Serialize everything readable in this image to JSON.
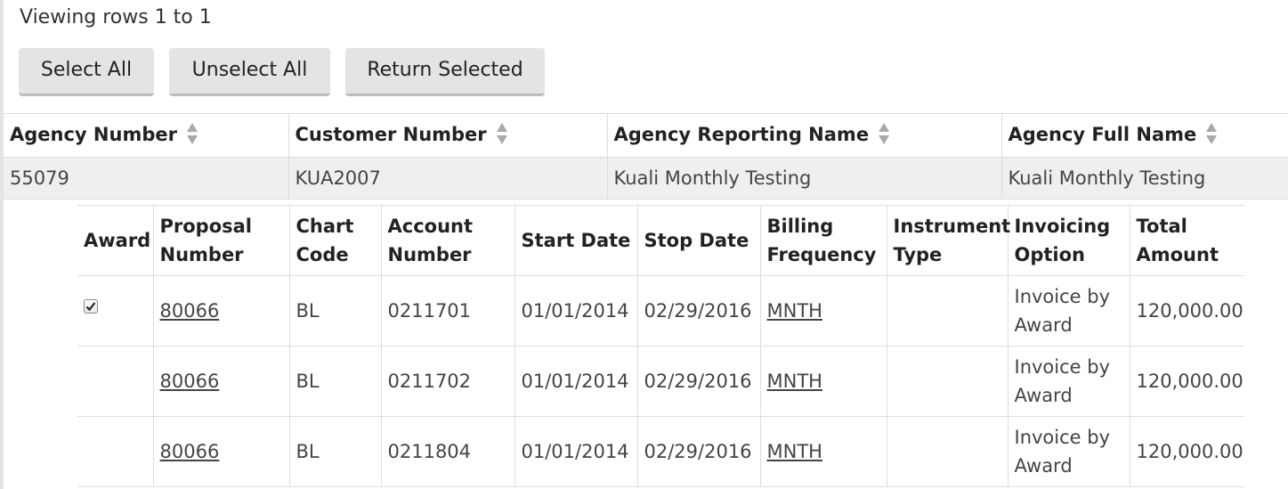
{
  "viewing_text": "Viewing rows 1 to 1",
  "buttons": {
    "select_all": "Select All",
    "unselect_all": "Unselect All",
    "return_selected": "Return Selected"
  },
  "outer_table": {
    "headers": [
      "Agency Number",
      "Customer Number",
      "Agency Reporting Name",
      "Agency Full Name"
    ],
    "rows": [
      [
        "55079",
        "KUA2007",
        "Kuali Monthly Testing",
        "Kuali Monthly Testing"
      ]
    ]
  },
  "inner_table": {
    "headers": [
      "Award",
      "Proposal Number",
      "Chart Code",
      "Account Number",
      "Start Date",
      "Stop Date",
      "Billing Frequency",
      "Instrument Type",
      "Invoicing Option",
      "Total Amount"
    ],
    "rows": [
      {
        "award_checked": true,
        "proposal": "80066",
        "chart": "BL",
        "account": "0211701",
        "start": "01/01/2014",
        "stop": "02/29/2016",
        "billing": "MNTH",
        "instrument": "",
        "invoicing": "Invoice by Award",
        "total": "120,000.00"
      },
      {
        "award_checked": false,
        "proposal": "80066",
        "chart": "BL",
        "account": "0211702",
        "start": "01/01/2014",
        "stop": "02/29/2016",
        "billing": "MNTH",
        "instrument": "",
        "invoicing": "Invoice by Award",
        "total": "120,000.00"
      },
      {
        "award_checked": false,
        "proposal": "80066",
        "chart": "BL",
        "account": "0211804",
        "start": "01/01/2014",
        "stop": "02/29/2016",
        "billing": "MNTH",
        "instrument": "",
        "invoicing": "Invoice by Award",
        "total": "120,000.00"
      }
    ]
  },
  "icons": {
    "sort": "sort-icon",
    "checkbox_checked": "checkbox-checked-icon"
  }
}
